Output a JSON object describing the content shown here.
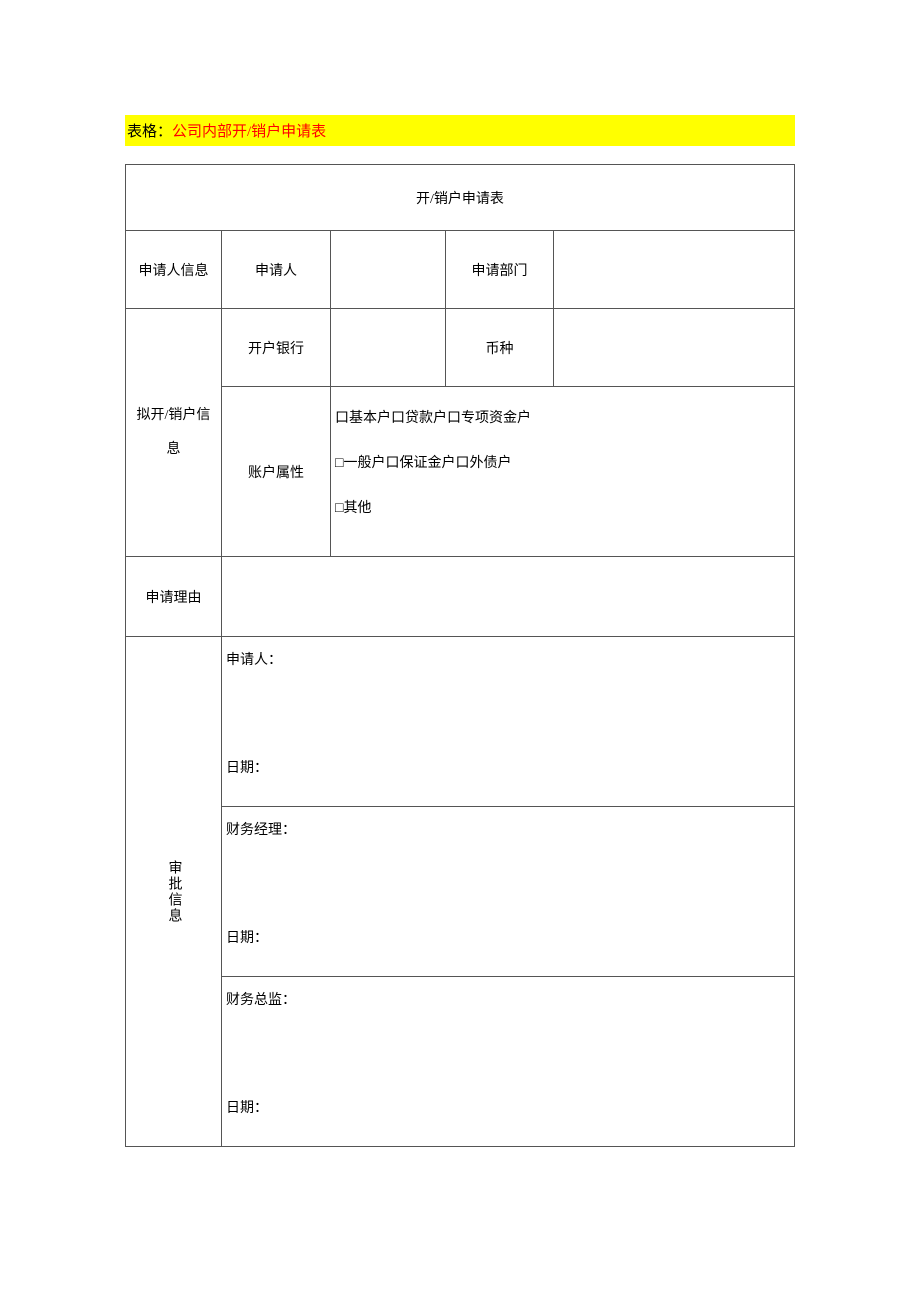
{
  "highlight": {
    "prefix": "表格：",
    "name": "公司内部开/销户申请表"
  },
  "table": {
    "title": "开/销户申请表",
    "applicant_info": "申请人信息",
    "applicant": "申请人",
    "dept": "申请部门",
    "account_info": "拟开/销户信息",
    "bank": "开户银行",
    "currency": "币种",
    "attr": "账户属性",
    "types_line1": "口基本户口贷款户口专项资金户",
    "types_line2": "□一般户口保证金户口外债户",
    "types_line3": "□其他",
    "reason": "申请理由",
    "approval": "审批信息",
    "sign1_top": "申请人：",
    "sign1_bot": "日期：",
    "sign2_top": "财务经理：",
    "sign2_bot": "日期：",
    "sign3_top": "财务总监：",
    "sign3_bot": "日期："
  }
}
